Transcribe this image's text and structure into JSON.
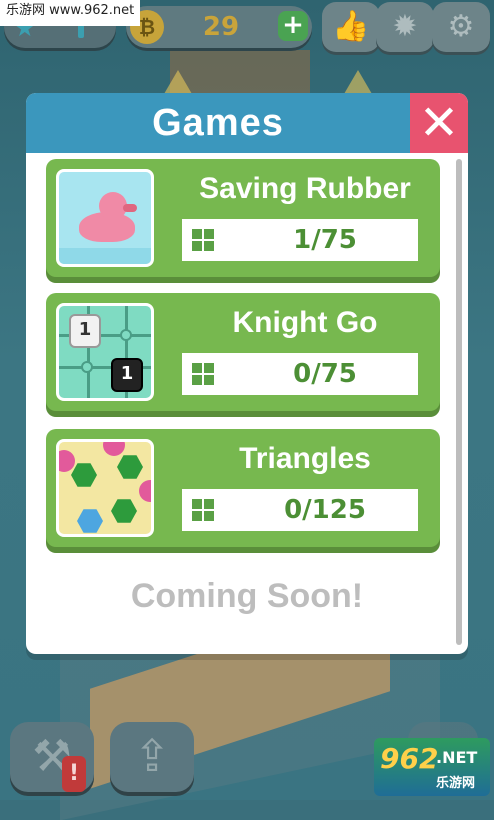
{
  "watermark": {
    "top": "乐游网 www.962.net",
    "bottom_num": "962",
    "bottom_net": ".NET",
    "bottom_cn": "乐游网"
  },
  "hud": {
    "coin_symbol": "₿",
    "coins": "29",
    "plus": "+"
  },
  "modal": {
    "title": "Games",
    "close": "✕",
    "games": [
      {
        "name": "Saving Rubber Duck",
        "progress": "1/75"
      },
      {
        "name": "Knight Go",
        "progress": "0/75"
      },
      {
        "name": "Triangles",
        "progress": "0/125"
      }
    ],
    "coming_soon": "Coming Soon!"
  },
  "knight_pieces": {
    "white": "1",
    "black": "1"
  },
  "alert": "!",
  "icons": [
    "star-icon",
    "coin-icon",
    "plus-icon",
    "thumbs-up-icon",
    "award-icon",
    "gear-icon",
    "close-icon",
    "grid-icon",
    "tools-icon",
    "share-icon",
    "play-icon"
  ],
  "colors": {
    "header_blue": "#3b97bd",
    "close_pink": "#e8536f",
    "card_green": "#77b84f"
  }
}
